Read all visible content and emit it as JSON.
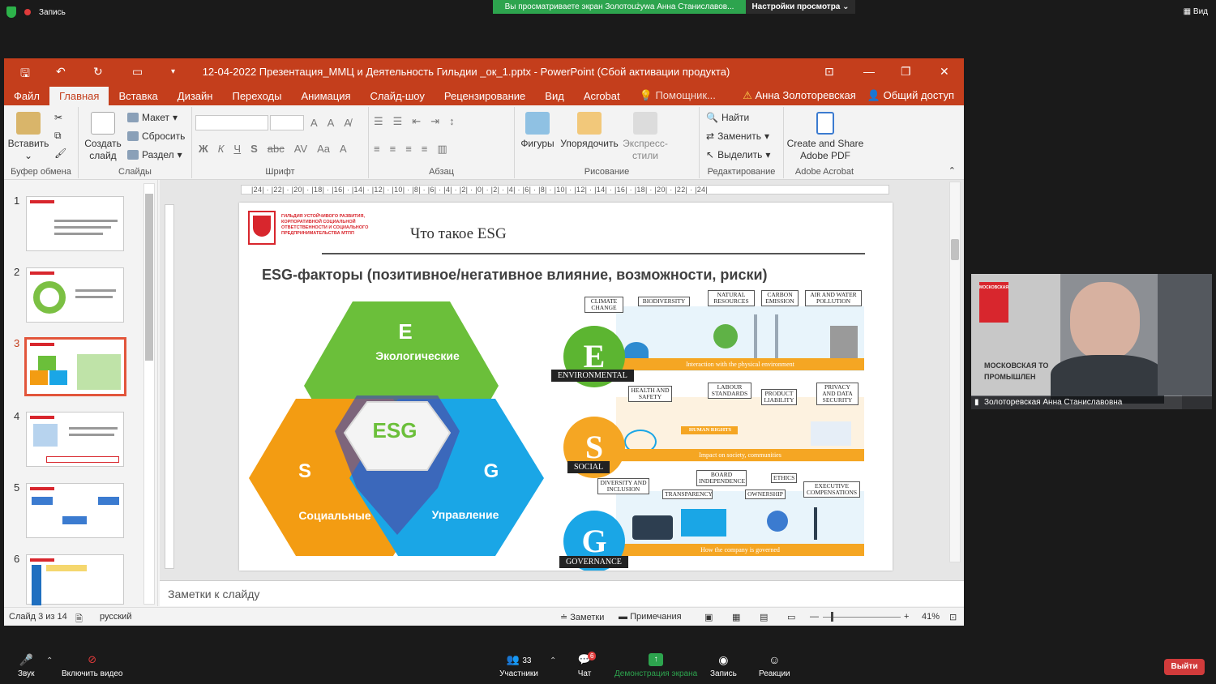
{
  "zoom_top": {
    "recording": "Запись",
    "banner": "Вы просматриваете экран Золотоużywa Анна Станиславов...",
    "view_settings": "Настройки просмотра ⌄",
    "view": "Вид"
  },
  "ppt": {
    "title": "12-04-2022 Презентация_ММЦ и Деятельность Гильдии _ок_1.pptx  -  PowerPoint (Сбой активации продукта)",
    "menu": [
      "Файл",
      "Главная",
      "Вставка",
      "Дизайн",
      "Переходы",
      "Анимация",
      "Слайд-шоу",
      "Рецензирование",
      "Вид",
      "Acrobat",
      "Помощник..."
    ],
    "user": "Анна Золоторевская",
    "share": "Общий доступ",
    "ribbon": {
      "paste": "Вставить",
      "clipboard": "Буфер обмена",
      "create_slide": "Создать слайд",
      "layout": "Макет",
      "reset": "Сбросить",
      "section": "Раздел",
      "slides": "Слайды",
      "font": "Шрифт",
      "paragraph": "Абзац",
      "shapes": "Фигуры",
      "arrange": "Упорядочить",
      "express": "Экспресс-стили",
      "drawing": "Рисование",
      "find": "Найти",
      "replace": "Заменить",
      "select": "Выделить",
      "editing": "Редактирование",
      "create_pdf": "Create and Share Adobe PDF",
      "acrobat": "Adobe Acrobat"
    },
    "thumb_numbers": [
      "1",
      "2",
      "3",
      "4",
      "5",
      "6"
    ],
    "ruler": "|24| · |22| · |20| · |18| · |16| · |14| · |12| · |10| · |8| · |6| · |4| · |2| · |0| · |2| · |4| · |6| · |8| · |10| · |12| · |14| · |16| · |18| · |20| · |22| · |24|",
    "notes": "Заметки к слайду",
    "status": {
      "slide": "Слайд 3 из 14",
      "lang": "русский",
      "notes": "Заметки",
      "comments": "Примечания",
      "zoom": "41%"
    }
  },
  "slide": {
    "guild": "ГИЛЬДИЯ УСТОЙЧИВОГО РАЗВИТИЯ, КОРПОРАТИВНОЙ СОЦИАЛЬНОЙ ОТВЕТСТВЕННОСТИ И СОЦИАЛЬНОГО ПРЕДПРИНИМАТЕЛЬСТВА МТПП",
    "title": "Что такое ESG",
    "subtitle": "ESG-факторы (позитивное/негативное влияние, возможности, риски)",
    "hex": {
      "e_letter": "E",
      "e_word": "Экологические",
      "s_letter": "S",
      "s_word": "Социальные",
      "g_letter": "G",
      "g_word": "Управление",
      "center": "ESG"
    },
    "right": {
      "env_tags": [
        "CLIMATE CHANGE",
        "BIODIVERSITY",
        "NATURAL RESOURCES",
        "CARBON EMISSION",
        "AIR AND WATER POLLUTION"
      ],
      "env_band": "Interaction with the physical environment",
      "env_name": "ENVIRONMENTAL",
      "soc_tags": [
        "HEALTH AND SAFETY",
        "LABOUR STANDARDS",
        "PRODUCT LIABILITY",
        "PRIVACY AND DATA SECURITY"
      ],
      "soc_band": "Impact on society, communities",
      "soc_name": "SOCIAL",
      "soc_sign": "HUMAN RIGHTS",
      "gov_tags": [
        "DIVERSITY AND INCLUSION",
        "TRANSPARENCY",
        "BOARD INDEPENDENCE",
        "OWNERSHIP",
        "ETHICS",
        "EXECUTIVE COMPENSATIONS"
      ],
      "gov_band": "How the company is governed",
      "gov_name": "GOVERNANCE",
      "letters": [
        "E",
        "S",
        "G"
      ]
    }
  },
  "video": {
    "name": "Золоторевская Анна Станиславовна",
    "logo_text": "МОСКОВСКАЯ",
    "bg_text": "МОСКОВСКАЯ ТО",
    "bg_text2": "ПРОМЫШЛЕН"
  },
  "zoom_bottom": {
    "mic": "Звук",
    "video": "Включить видео",
    "participants": "Участники",
    "participants_count": "33",
    "chat": "Чат",
    "chat_badge": "6",
    "share": "Демонстрация экрана",
    "record": "Запись",
    "reactions": "Реакции",
    "leave": "Выйти"
  },
  "colors": {
    "ppt_red": "#c43e1c",
    "hex_green": "#6bbf3a",
    "hex_orange": "#f39c12",
    "hex_blue": "#1aa6e6",
    "zoom_green": "#2da44e"
  }
}
